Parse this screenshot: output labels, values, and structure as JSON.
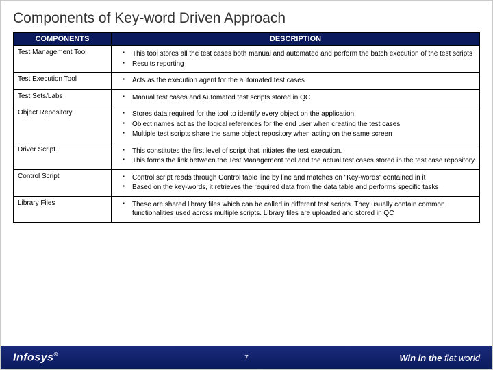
{
  "title": "Components of Key-word Driven Approach",
  "headers": {
    "col1": "COMPONENTS",
    "col2": "DESCRIPTION"
  },
  "rows": [
    {
      "component": "Test Management Tool",
      "bullets": [
        "This tool stores all the test cases both manual and automated and perform the batch execution of the test scripts",
        "Results reporting"
      ]
    },
    {
      "component": "Test Execution Tool",
      "bullets": [
        "Acts as the execution agent for the automated test cases"
      ]
    },
    {
      "component": "Test Sets/Labs",
      "bullets": [
        "Manual test cases and Automated test scripts stored in QC"
      ]
    },
    {
      "component": "Object Repository",
      "bullets": [
        "Stores data required for the tool to identify every object on the application",
        "Object names act as the logical references for the end user when creating the test cases",
        "Multiple test scripts share the same object repository when acting on the same screen"
      ]
    },
    {
      "component": "Driver Script",
      "bullets": [
        "This constitutes the first level of script that initiates the test execution.",
        "This forms the link between the Test  Management tool and the actual  test cases stored in the test case repository"
      ]
    },
    {
      "component": "Control Script",
      "bullets": [
        "Control script reads through Control table line by line and matches  on \"Key-words\" contained in it",
        "Based on the key-words, it retrieves the required data from the data table and performs specific tasks"
      ]
    },
    {
      "component": "Library Files",
      "bullets": [
        "These are shared library files which can be called in different test scripts. They usually contain common functionalities used across multiple scripts. Library files are uploaded and stored in QC"
      ]
    }
  ],
  "footer": {
    "brand": "Infosys",
    "reg": "®",
    "page": "7",
    "tagline_bold": "Win in the ",
    "tagline_flat": "flat world"
  }
}
